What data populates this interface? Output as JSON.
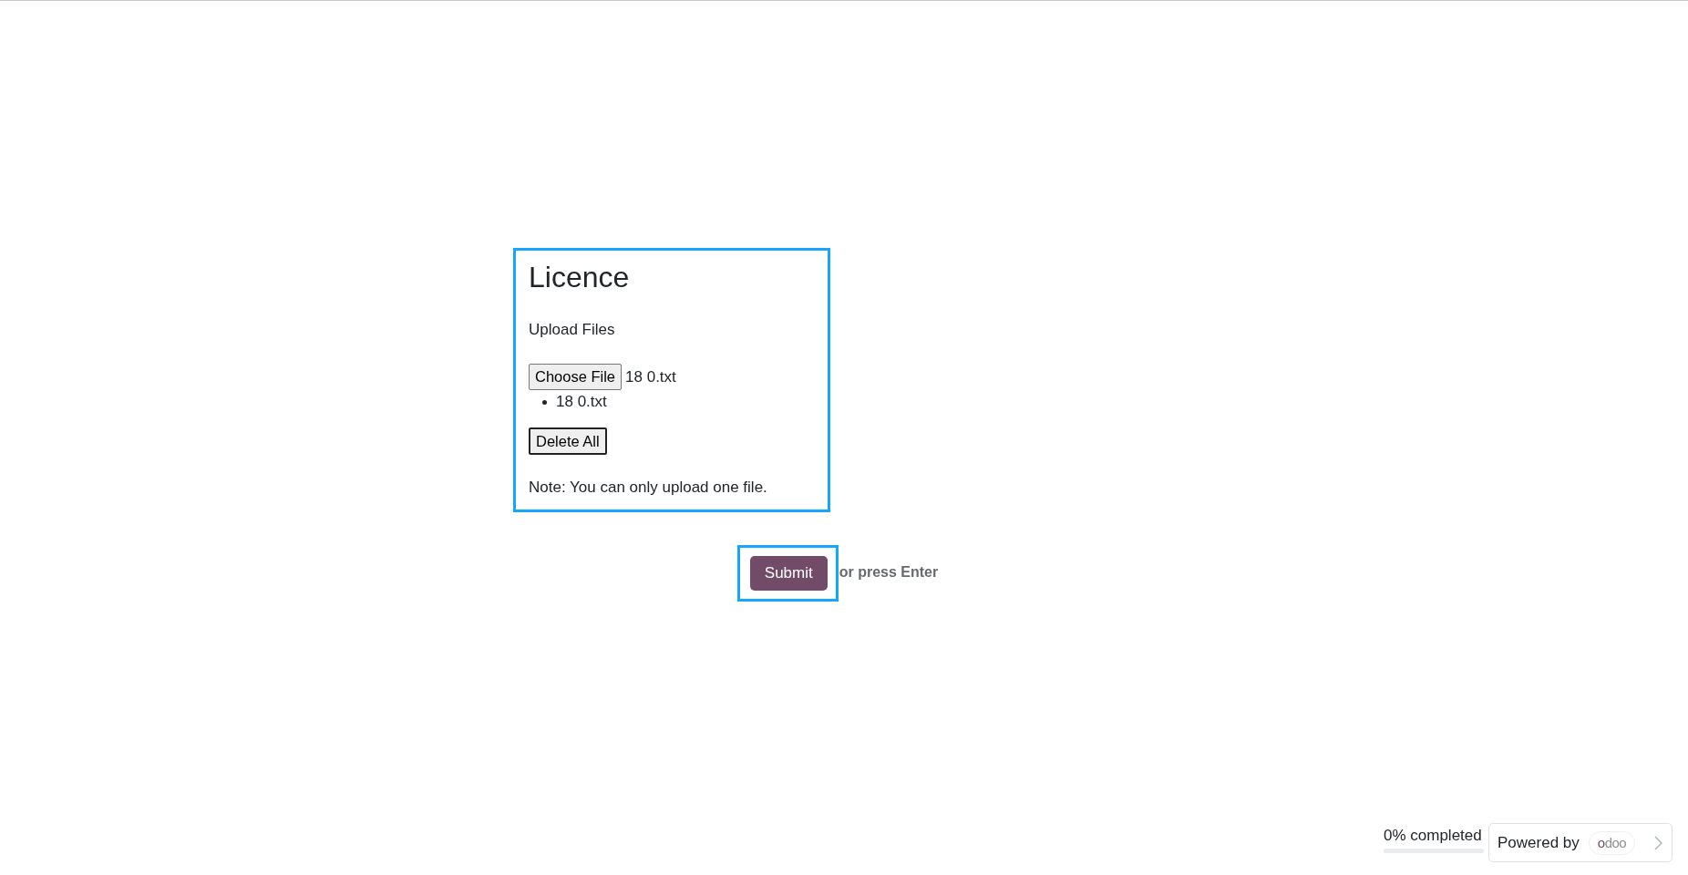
{
  "questions": [
    {
      "title": "Licence",
      "highlighted": true,
      "description": "Upload Files",
      "file_input": {
        "button": "Choose File",
        "value": "18 0.txt"
      },
      "files": [
        "18 0.txt"
      ],
      "delete_button": "Delete All",
      "note": "Note: You can only upload one file."
    }
  ],
  "submit": {
    "label": "Submit",
    "highlighted": true,
    "hint": "or press Enter"
  },
  "footer": {
    "progress": {
      "label": "0% completed",
      "level": 0
    },
    "branding": {
      "text": "Powered by",
      "logo": "odoo"
    }
  }
}
